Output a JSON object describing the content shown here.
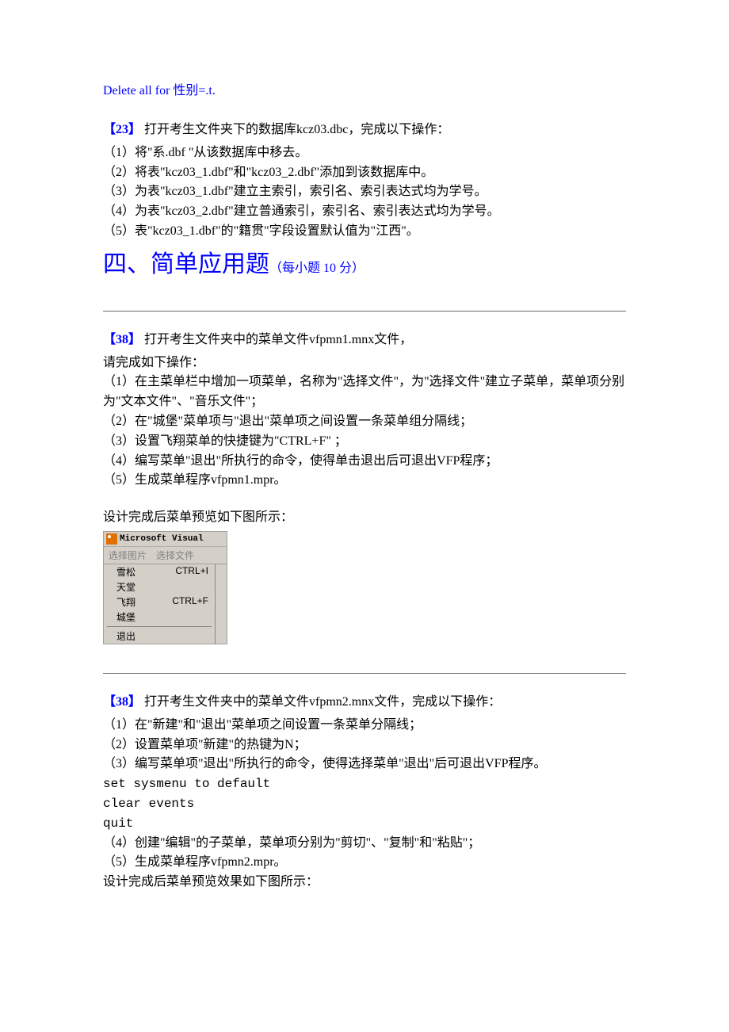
{
  "code_top": "Delete all for 性别=.t.",
  "q23": {
    "num": "【23】",
    "intro": " 打开考生文件夹下的数据库kcz03.dbc，完成以下操作：",
    "steps": [
      "（1）将\"系.dbf \"从该数据库中移去。",
      "（2）将表\"kcz03_1.dbf\"和\"kcz03_2.dbf\"添加到该数据库中。",
      "（3）为表\"kcz03_1.dbf\"建立主索引，索引名、索引表达式均为学号。",
      "（4）为表\"kcz03_2.dbf\"建立普通索引，索引名、索引表达式均为学号。",
      "（5）表\"kcz03_1.dbf\"的\"籍贯\"字段设置默认值为\"江西\"。"
    ]
  },
  "section4": {
    "title": "四、简单应用题",
    "sub": "（每小题 10 分）"
  },
  "q38a": {
    "num": "【38】",
    "intro": " 打开考生文件夹中的菜单文件vfpmn1.mnx文件，",
    "pre": "请完成如下操作：",
    "steps": [
      "（1）在主菜单栏中增加一项菜单，名称为\"选择文件\"，为\"选择文件\"建立子菜单，菜单项分别为\"文本文件\"、\"音乐文件\"；",
      "（2）在\"城堡\"菜单项与\"退出\"菜单项之间设置一条菜单组分隔线；",
      "（3）设置飞翔菜单的快捷键为\"CTRL+F\" ；",
      "（4）编写菜单\"退出\"所执行的命令，使得单击退出后可退出VFP程序；",
      "（5）生成菜单程序vfpmn1.mpr。"
    ],
    "preview_caption": "设计完成后菜单预览如下图所示："
  },
  "preview_menu": {
    "title": "Microsoft Visual",
    "menubar": [
      "选择图片",
      "选择文件"
    ],
    "items": [
      {
        "label": "雪松",
        "shortcut": "CTRL+I"
      },
      {
        "label": "天堂",
        "shortcut": ""
      },
      {
        "label": "飞翔",
        "shortcut": "CTRL+F"
      },
      {
        "label": "城堡",
        "shortcut": ""
      }
    ],
    "after_sep": [
      {
        "label": "退出",
        "shortcut": ""
      }
    ]
  },
  "q38b": {
    "num": "【38】",
    "intro": " 打开考生文件夹中的菜单文件vfpmn2.mnx文件，完成以下操作：",
    "steps_pre": [
      "（1）在\"新建\"和\"退出\"菜单项之间设置一条菜单分隔线；",
      "（2）设置菜单项\"新建\"的热键为N；",
      "（3）编写菜单项\"退出\"所执行的命令，使得选择菜单\"退出\"后可退出VFP程序。"
    ],
    "code": [
      "set sysmenu to default",
      "clear events",
      "quit"
    ],
    "steps_post": [
      "（4）创建\"编辑\"的子菜单，菜单项分别为\"剪切\"、\"复制\"和\"粘贴\"；",
      "（5）生成菜单程序vfpmn2.mpr。"
    ],
    "end": "设计完成后菜单预览效果如下图所示："
  }
}
